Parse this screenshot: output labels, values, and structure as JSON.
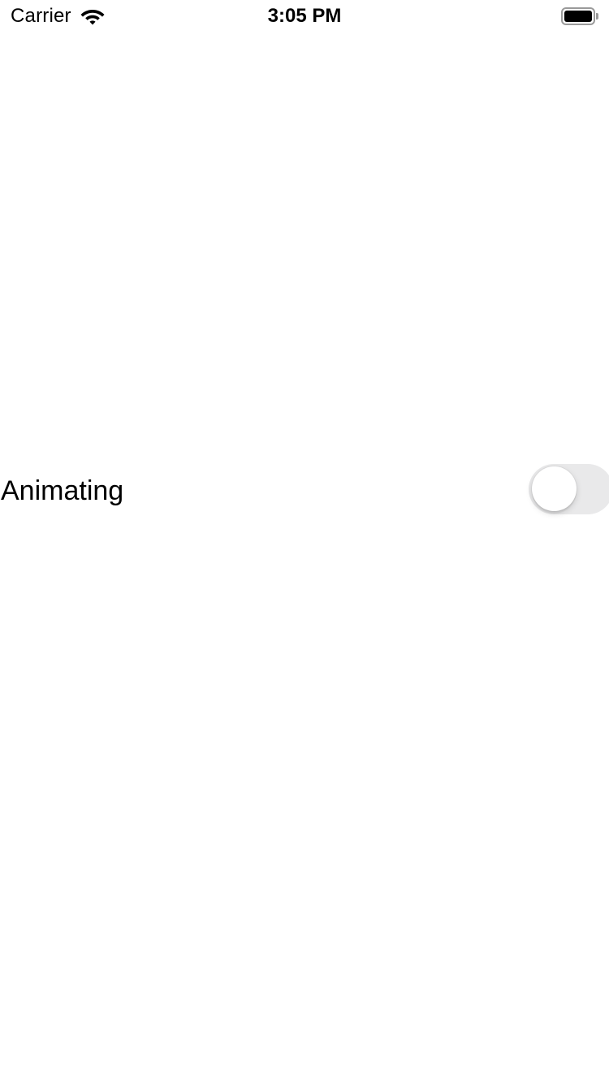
{
  "status_bar": {
    "carrier": "Carrier",
    "time": "3:05 PM",
    "wifi_icon": "wifi-icon",
    "battery_icon": "battery-full-icon"
  },
  "row": {
    "label": "Animating",
    "toggle_on": false,
    "toggle_track_color": "#e9e9ea"
  }
}
